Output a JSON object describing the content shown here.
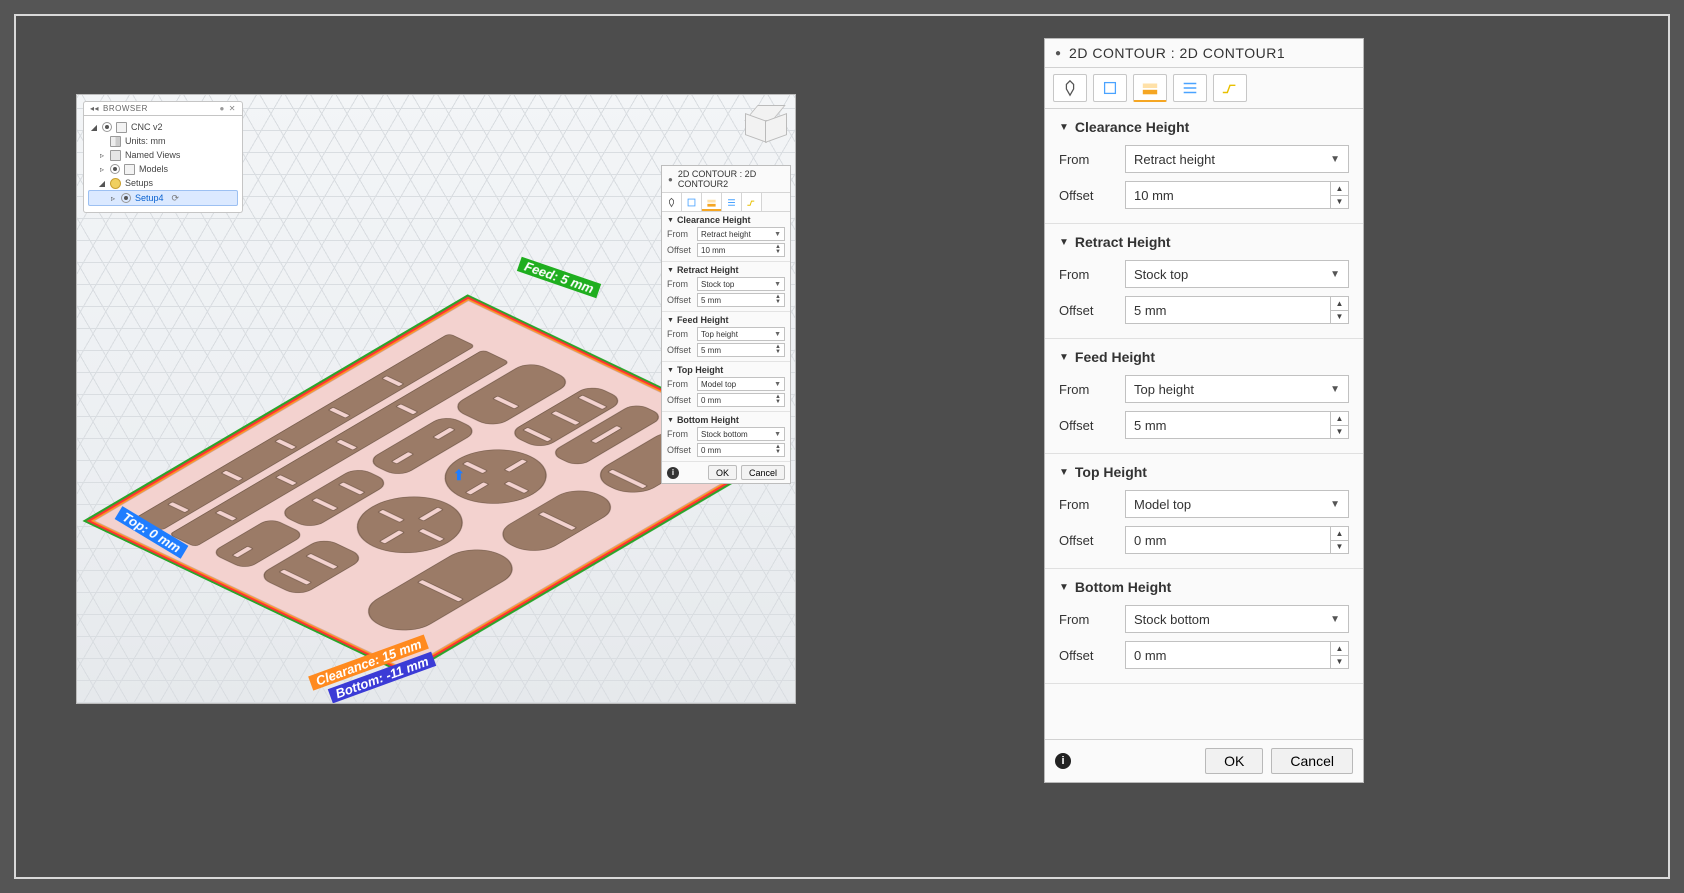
{
  "browser": {
    "title": "BROWSER",
    "root_name": "CNC v2",
    "units": "Units: mm",
    "named_views": "Named Views",
    "models": "Models",
    "setups": "Setups",
    "active_setup": "Setup4"
  },
  "viewport_labels": {
    "feed": "Feed: 5 mm",
    "top": "Top: 0 mm",
    "clearance": "Clearance: 15 mm",
    "bottom": "Bottom: -11 mm"
  },
  "mini_panel": {
    "title": "2D CONTOUR : 2D CONTOUR2",
    "sections": {
      "clearance": {
        "title": "Clearance Height",
        "from_label": "From",
        "from": "Retract height",
        "offset_label": "Offset",
        "offset": "10 mm"
      },
      "retract": {
        "title": "Retract Height",
        "from_label": "From",
        "from": "Stock top",
        "offset_label": "Offset",
        "offset": "5 mm"
      },
      "feed": {
        "title": "Feed Height",
        "from_label": "From",
        "from": "Top height",
        "offset_label": "Offset",
        "offset": "5 mm"
      },
      "top": {
        "title": "Top Height",
        "from_label": "From",
        "from": "Model top",
        "offset_label": "Offset",
        "offset": "0 mm"
      },
      "bottom": {
        "title": "Bottom Height",
        "from_label": "From",
        "from": "Stock bottom",
        "offset_label": "Offset",
        "offset": "0 mm"
      }
    },
    "ok": "OK",
    "cancel": "Cancel"
  },
  "big_panel": {
    "title": "2D CONTOUR : 2D CONTOUR1",
    "sections": {
      "clearance": {
        "title": "Clearance Height",
        "from_label": "From",
        "from": "Retract height",
        "offset_label": "Offset",
        "offset": "10 mm"
      },
      "retract": {
        "title": "Retract Height",
        "from_label": "From",
        "from": "Stock top",
        "offset_label": "Offset",
        "offset": "5 mm"
      },
      "feed": {
        "title": "Feed Height",
        "from_label": "From",
        "from": "Top height",
        "offset_label": "Offset",
        "offset": "5 mm"
      },
      "top": {
        "title": "Top Height",
        "from_label": "From",
        "from": "Model top",
        "offset_label": "Offset",
        "offset": "0 mm"
      },
      "bottom": {
        "title": "Bottom Height",
        "from_label": "From",
        "from": "Stock bottom",
        "offset_label": "Offset",
        "offset": "0 mm"
      }
    },
    "ok": "OK",
    "cancel": "Cancel"
  },
  "icons": {
    "tool": "tool-tab-icon",
    "geometry": "geometry-tab-icon",
    "heights": "heights-tab-icon",
    "passes": "passes-tab-icon",
    "linking": "linking-tab-icon"
  }
}
